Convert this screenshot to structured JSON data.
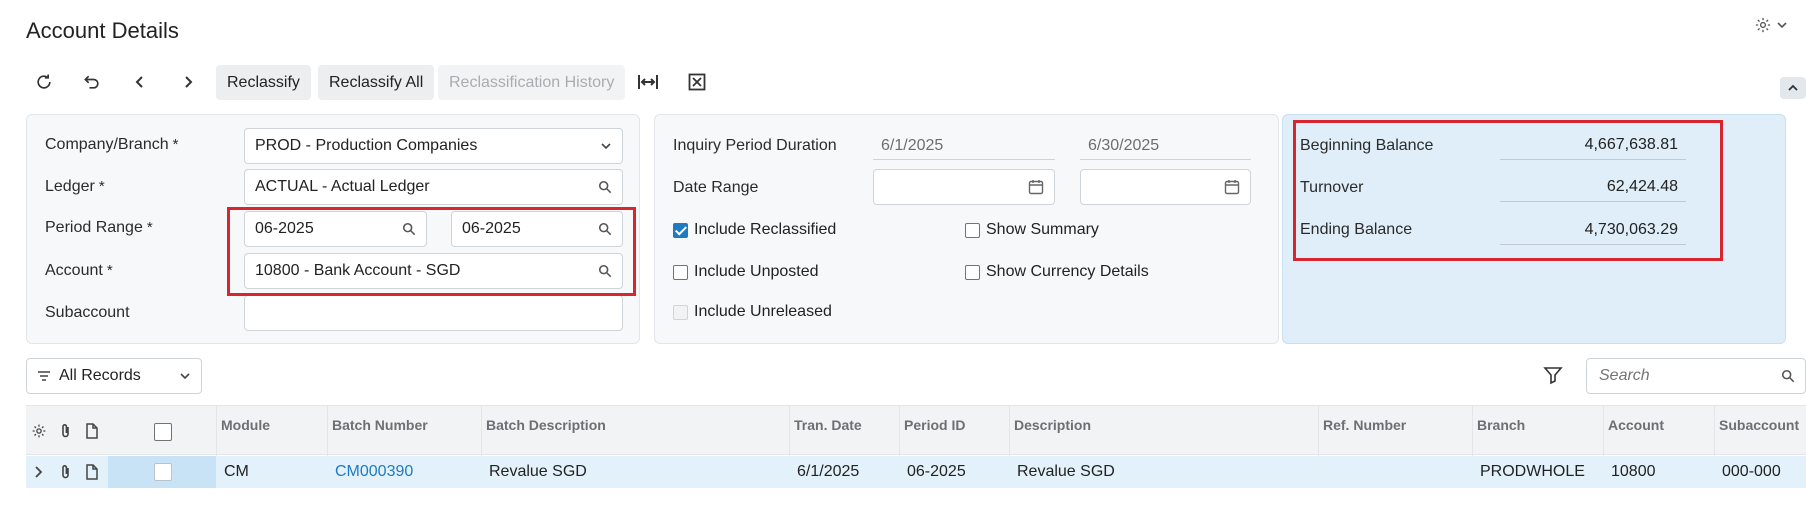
{
  "page": {
    "title": "Account Details"
  },
  "toolbar": {
    "reclassify": "Reclassify",
    "reclassify_all": "Reclassify All",
    "reclassification_history": "Reclassification History"
  },
  "filters": {
    "company_branch": {
      "label": "Company/Branch",
      "required": "*",
      "value": "PROD - Production Companies"
    },
    "ledger": {
      "label": "Ledger",
      "required": "*",
      "value": "ACTUAL - Actual Ledger"
    },
    "period_range": {
      "label": "Period Range",
      "required": "*",
      "from": "06-2025",
      "to": "06-2025"
    },
    "account": {
      "label": "Account",
      "required": "*",
      "value": "10800 - Bank Account - SGD"
    },
    "subaccount": {
      "label": "Subaccount",
      "value": ""
    }
  },
  "period": {
    "inquiry_label": "Inquiry Period Duration",
    "start": "6/1/2025",
    "end": "6/30/2025",
    "date_range_label": "Date Range",
    "include_reclassified": "Include Reclassified",
    "include_unposted": "Include Unposted",
    "include_unreleased": "Include Unreleased",
    "show_summary": "Show Summary",
    "show_currency_details": "Show Currency Details"
  },
  "balances": {
    "beginning_label": "Beginning Balance",
    "beginning_value": "4,667,638.81",
    "turnover_label": "Turnover",
    "turnover_value": "62,424.48",
    "ending_label": "Ending Balance",
    "ending_value": "4,730,063.29"
  },
  "grid_toolbar": {
    "records_filter": "All Records",
    "search_placeholder": "Search"
  },
  "grid": {
    "columns": {
      "module": "Module",
      "batch_number": "Batch Number",
      "batch_description": "Batch Description",
      "tran_date": "Tran. Date",
      "period_id": "Period ID",
      "description": "Description",
      "ref_number": "Ref. Number",
      "branch": "Branch",
      "account": "Account",
      "subaccount": "Subaccount"
    },
    "rows": [
      {
        "module": "CM",
        "batch_number": "CM000390",
        "batch_description": "Revalue SGD",
        "tran_date": "6/1/2025",
        "period_id": "06-2025",
        "description": "Revalue SGD",
        "ref_number": "",
        "branch": "PRODWHOLE",
        "account": "10800",
        "subaccount": "000-000"
      }
    ]
  },
  "colors": {
    "accent": "#1f7bc1",
    "highlight_border": "#d7262f",
    "balance_panel": "#dfeef8",
    "selected_row": "#e3f1fa"
  }
}
